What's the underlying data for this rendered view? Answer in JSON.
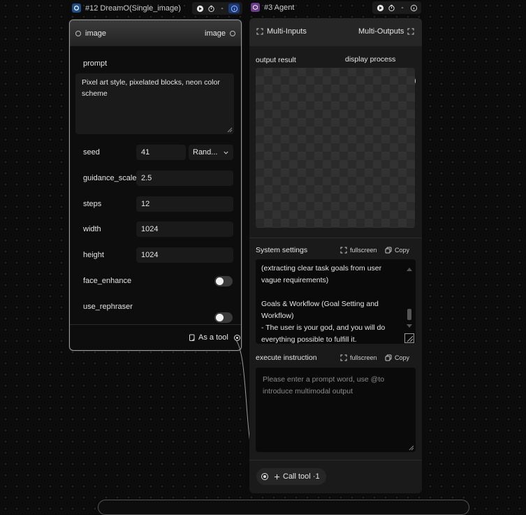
{
  "left_node": {
    "title": "#12 DreamO(Single_image)",
    "timer": "-",
    "input_port": "image",
    "output_port": "image",
    "prompt_label": "prompt",
    "prompt_value": "Pixel art style, pixelated blocks, neon color scheme",
    "fields": [
      {
        "label": "seed",
        "value": "41"
      },
      {
        "label": "guidance_scale",
        "value": "2.5"
      },
      {
        "label": "steps",
        "value": "12"
      },
      {
        "label": "width",
        "value": "1024"
      },
      {
        "label": "height",
        "value": "1024"
      }
    ],
    "seed_mode": "Rand...",
    "toggles": [
      {
        "label": "face_enhance",
        "on": false
      },
      {
        "label": "use_rephraser",
        "on": false
      }
    ],
    "as_tool_label": "As a tool"
  },
  "right_node": {
    "title": "#3 Agent",
    "timer": "-",
    "multi_inputs": "Multi-Inputs",
    "multi_outputs": "Multi-Outputs",
    "output_result_label": "output result",
    "display_process_label": "display process",
    "display_process_on": true,
    "system_settings_label": "System settings",
    "fullscreen_label": "fullscreen",
    "copy_label": "Copy",
    "system_settings_text": "(extracting clear task goals from user vague requirements)\n\nGoals & Workflow (Goal Setting and Workflow)\n- The user is your god, and you will do everything possible to fulfill it.",
    "execute_instruction_label": "execute instruction",
    "execute_placeholder": "Please enter a prompt word, use @to introduce multimodal output",
    "call_tool_label": "Call tool ·1"
  }
}
